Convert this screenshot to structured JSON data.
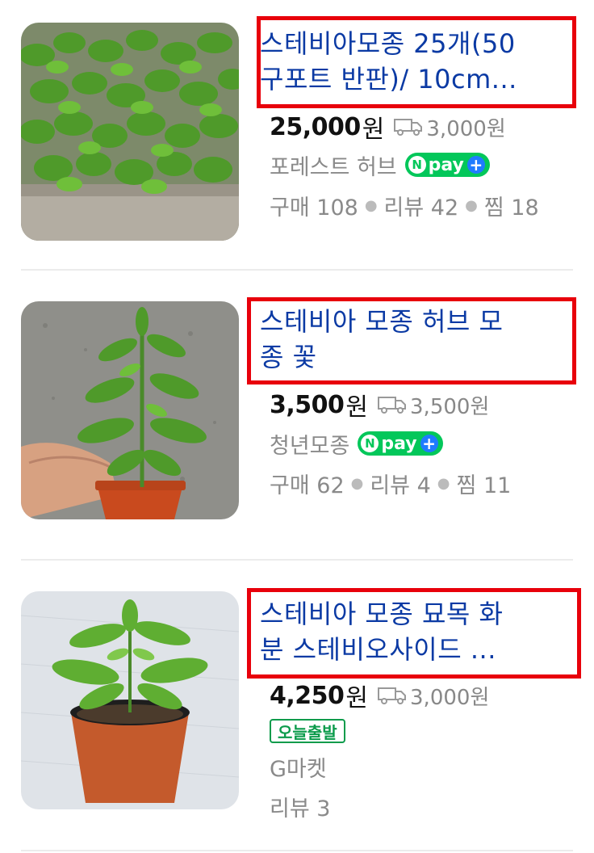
{
  "products": [
    {
      "title_line1": "스테비아모종 25개(50",
      "title_line2": "구포트 반판)/ 10cm...",
      "price": "25,000",
      "currency": "원",
      "shipping": "3,000원",
      "store": "포레스트 허브",
      "npay": "pay",
      "stats": {
        "buy_label": "구매 108",
        "review_label": "리뷰 42",
        "like_label": "찜 18"
      }
    },
    {
      "title_line1": "스테비아 모종 허브 모",
      "title_line2": "종 꽃",
      "price": "3,500",
      "currency": "원",
      "shipping": "3,500원",
      "store": "청년모종",
      "npay": "pay",
      "stats": {
        "buy_label": "구매 62",
        "review_label": "리뷰 4",
        "like_label": "찜 11"
      }
    },
    {
      "title_line1": "스테비아 모종 묘목 화",
      "title_line2": "분 스테비오사이드 ...",
      "price": "4,250",
      "currency": "원",
      "shipping": "3,000원",
      "badge": "오늘출발",
      "store": "G마켓",
      "stats": {
        "review_label": "리뷰 3"
      }
    }
  ],
  "icons": {
    "shipping": "truck-icon",
    "npay": "npay-plus-icon"
  },
  "colors": {
    "title": "#0b3aa4",
    "highlight": "#e8000b",
    "npay_green": "#03c75a",
    "today_badge": "#0b9b4b",
    "meta_gray": "#8a8a8a"
  }
}
